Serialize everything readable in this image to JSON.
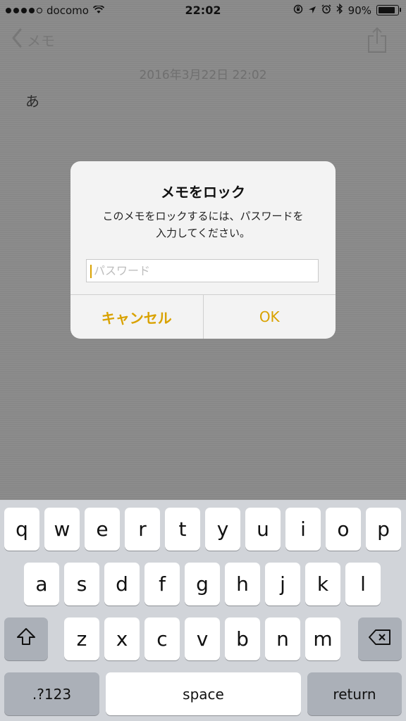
{
  "status": {
    "carrier": "docomo",
    "time": "22:02",
    "battery": "90%",
    "battery_level": 0.9
  },
  "nav": {
    "back_label": "メモ"
  },
  "note": {
    "date": "2016年3月22日 22:02",
    "text": "あ"
  },
  "dialog": {
    "title": "メモをロック",
    "message_line1": "このメモをロックするには、パスワードを",
    "message_line2": "入力してください。",
    "placeholder": "パスワード",
    "cancel": "キャンセル",
    "ok": "OK"
  },
  "keyboard": {
    "row1": [
      "q",
      "w",
      "e",
      "r",
      "t",
      "y",
      "u",
      "i",
      "o",
      "p"
    ],
    "row2": [
      "a",
      "s",
      "d",
      "f",
      "g",
      "h",
      "j",
      "k",
      "l"
    ],
    "row3": [
      "z",
      "x",
      "c",
      "v",
      "b",
      "n",
      "m"
    ],
    "numbers": ".?123",
    "space": "space",
    "return": "return"
  },
  "colors": {
    "accent": "#D9A200"
  }
}
